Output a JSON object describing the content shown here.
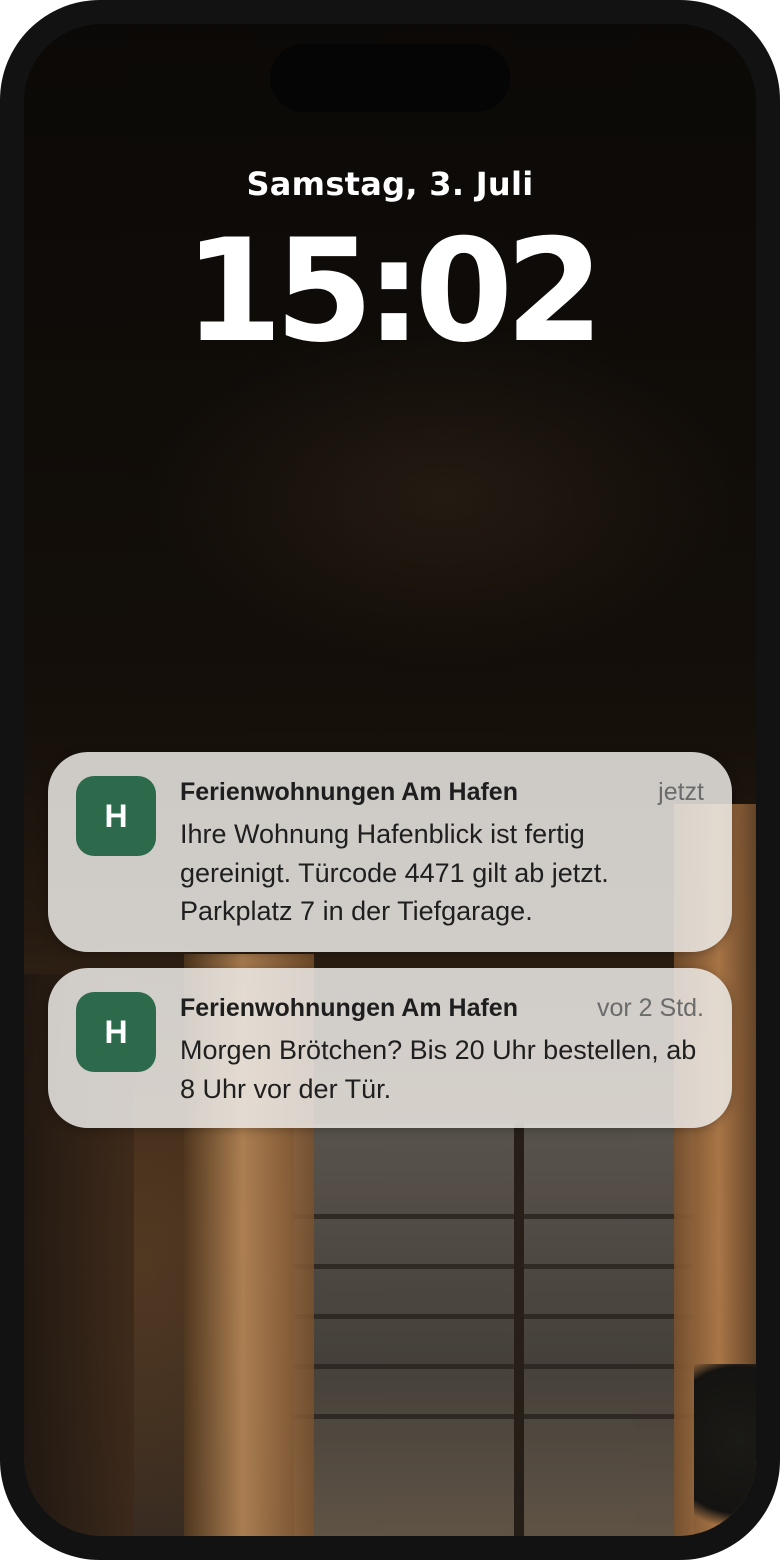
{
  "lockscreen": {
    "date": "Samstag, 3. Juli",
    "time": "15:02"
  },
  "notifications": [
    {
      "app_icon_letter": "H",
      "app_icon_color": "#2c6a4b",
      "app_name": "Ferienwohnungen Am Hafen",
      "time": "jetzt",
      "message": "Ihre Wohnung Hafenblick ist fertig gereinigt. Türcode 4471 gilt ab jetzt. Parkplatz 7 in der Tiefgarage."
    },
    {
      "app_icon_letter": "H",
      "app_icon_color": "#2c6a4b",
      "app_name": "Ferienwohnungen Am Hafen",
      "time": "vor 2 Std.",
      "message": "Morgen Brötchen? Bis 20 Uhr bestellen, ab 8 Uhr vor der Tür."
    }
  ]
}
